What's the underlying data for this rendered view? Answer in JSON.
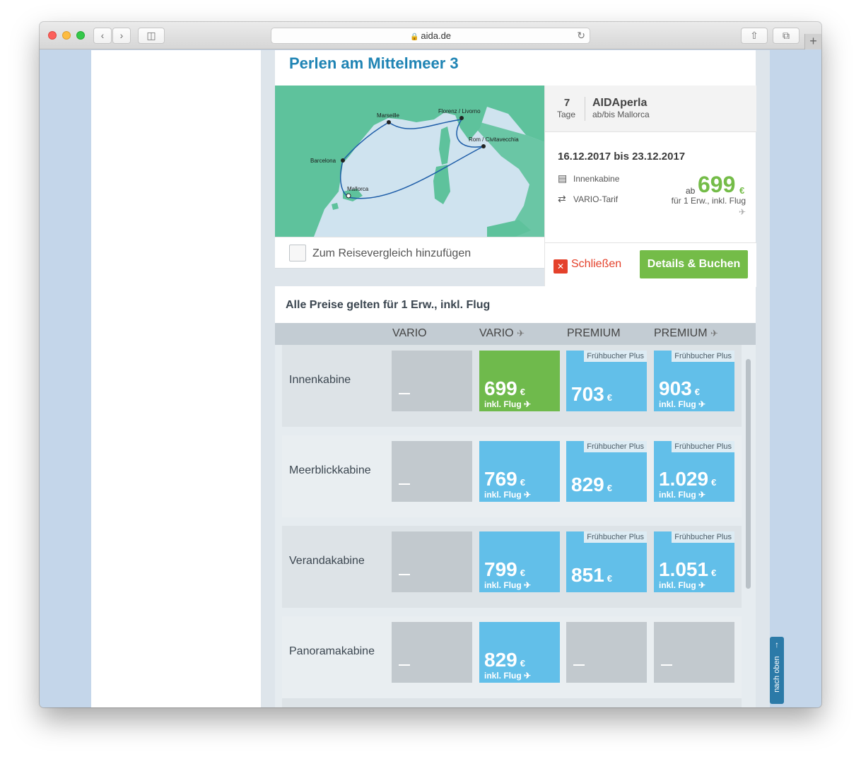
{
  "browser": {
    "url": "aida.de"
  },
  "card": {
    "title": "Perlen am Mittelmeer 3",
    "map_labels": [
      "Marseille",
      "Florenz / Livorno",
      "Rom / Civitavecchia",
      "Barcelona",
      "Mallorca"
    ],
    "compare_label": "Zum Reisevergleich hinzufügen"
  },
  "info": {
    "days_num": "7",
    "days_label": "Tage",
    "ship": "AIDAperla",
    "route": "ab/bis Mallorca",
    "dates": "16.12.2017 bis 23.12.2017",
    "cabin": "Innenkabine",
    "tariff": "VARIO-Tarif",
    "price_prefix": "ab",
    "price": "699",
    "currency": "€",
    "price_note": "für 1 Erw., inkl. Flug",
    "close_label": "Schließen",
    "book_label": "Details & Buchen"
  },
  "prices": {
    "title": "Alle Preise gelten für 1 Erw., inkl. Flug",
    "headers": [
      "VARIO",
      "VARIO",
      "PREMIUM",
      "PREMIUM"
    ],
    "currency": "€",
    "flight_label": "inkl. Flug",
    "badge_label": "Frühbucher Plus",
    "dash": "_",
    "rows": [
      {
        "label": "Innenkabine",
        "cells": [
          "",
          "699",
          "703",
          "903"
        ]
      },
      {
        "label": "Meerblickkabine",
        "cells": [
          "",
          "769",
          "829",
          "1.029"
        ]
      },
      {
        "label": "Verandakabine",
        "cells": [
          "",
          "799",
          "851",
          "1.051"
        ]
      },
      {
        "label": "Panoramakabine",
        "cells": [
          "",
          "829",
          "",
          ""
        ]
      }
    ]
  },
  "nav": {
    "back_to_top": "nach oben"
  },
  "colors": {
    "accent_blue": "#1f84b4",
    "price_green": "#74bc48",
    "cell_blue": "#62bfe9",
    "cell_gray": "#c2c9ce",
    "close_red": "#e4412b"
  }
}
